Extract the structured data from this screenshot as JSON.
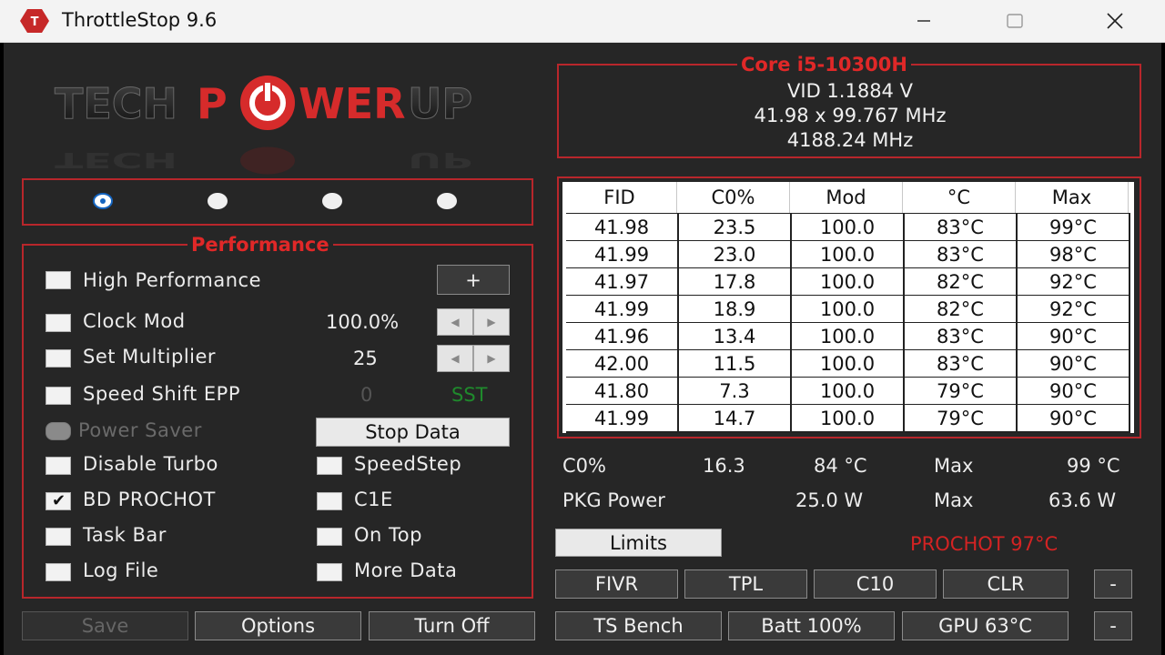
{
  "window": {
    "title": "ThrottleStop 9.6",
    "minimize_icon": "minimize-icon",
    "maximize_icon": "maximize-icon",
    "close_icon": "close-icon"
  },
  "logo": {
    "text": "TECHPOWERUP"
  },
  "profiles": {
    "selected": 0,
    "count": 4
  },
  "performance": {
    "legend": "Performance",
    "high_performance": {
      "label": "High Performance",
      "checked": false,
      "button": "+"
    },
    "clock_mod": {
      "label": "Clock Mod",
      "value": "100.0%",
      "checked": false
    },
    "set_multiplier": {
      "label": "Set Multiplier",
      "value": "25",
      "checked": false
    },
    "speed_shift": {
      "label": "Speed Shift EPP",
      "value": "0",
      "tag": "SST",
      "checked": false
    },
    "power_saver": {
      "label": "Power Saver",
      "checked": false
    },
    "stop_data": "Stop Data",
    "disable_turbo": {
      "label": "Disable Turbo",
      "checked": false
    },
    "speedstep": {
      "label": "SpeedStep",
      "checked": false
    },
    "bd_prochot": {
      "label": "BD PROCHOT",
      "checked": true
    },
    "c1e": {
      "label": "C1E",
      "checked": false
    },
    "task_bar": {
      "label": "Task Bar",
      "checked": false
    },
    "on_top": {
      "label": "On Top",
      "checked": false
    },
    "log_file": {
      "label": "Log File",
      "checked": false
    },
    "more_data": {
      "label": "More Data",
      "checked": false
    }
  },
  "bottom_left": {
    "save": "Save",
    "options": "Options",
    "turn_off": "Turn Off"
  },
  "core": {
    "legend": "Core i5-10300H",
    "vid": "VID  1.1884 V",
    "freq": "41.98 x 99.767 MHz",
    "total": "4188.24 MHz"
  },
  "table": {
    "headers": [
      "FID",
      "C0%",
      "Mod",
      "°C",
      "Max"
    ],
    "rows": [
      [
        "41.98",
        "23.5",
        "100.0",
        "83°C",
        "99°C"
      ],
      [
        "41.99",
        "23.0",
        "100.0",
        "83°C",
        "98°C"
      ],
      [
        "41.97",
        "17.8",
        "100.0",
        "82°C",
        "92°C"
      ],
      [
        "41.99",
        "18.9",
        "100.0",
        "82°C",
        "92°C"
      ],
      [
        "41.96",
        "13.4",
        "100.0",
        "83°C",
        "90°C"
      ],
      [
        "42.00",
        "11.5",
        "100.0",
        "83°C",
        "90°C"
      ],
      [
        "41.80",
        "7.3",
        "100.0",
        "79°C",
        "90°C"
      ],
      [
        "41.99",
        "14.7",
        "100.0",
        "79°C",
        "90°C"
      ]
    ]
  },
  "stats": {
    "c0_label": "C0%",
    "c0_value": "16.3",
    "temp": "84 °C",
    "max_label": "Max",
    "max_temp": "99 °C",
    "pkg_label": "PKG Power",
    "pkg_value": "25.0 W",
    "pkg_max_label": "Max",
    "pkg_max": "63.6 W"
  },
  "right_buttons": {
    "limits": "Limits",
    "prochot": "PROCHOT 97°C",
    "fivr": "FIVR",
    "tpl": "TPL",
    "c10": "C10",
    "clr": "CLR",
    "dash1": "-",
    "ts_bench": "TS Bench",
    "batt": "Batt 100%",
    "gpu": "GPU 63°C",
    "dash2": "-"
  }
}
